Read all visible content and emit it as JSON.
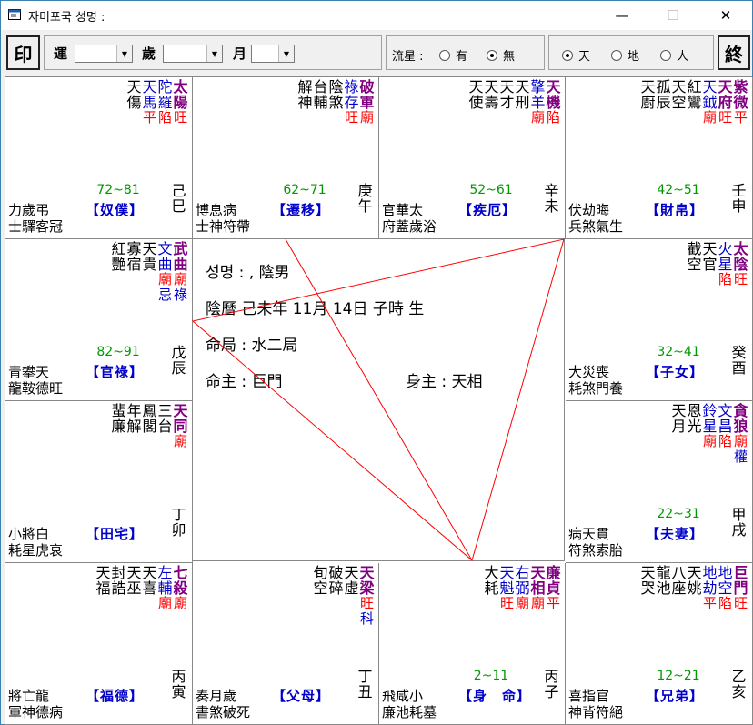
{
  "window": {
    "title": "자미포국    성명 :",
    "minimize": "—",
    "maximize": "☐",
    "close": "✕"
  },
  "toolbar": {
    "seal": "印",
    "yun": "運",
    "sui": "歲",
    "yue": "月",
    "liuxing": "流星 :",
    "you": "有",
    "wu": "無",
    "tian": "天",
    "di": "地",
    "ren": "人",
    "end": "終"
  },
  "center": {
    "name": "성명 : , 陰男",
    "birth": "陰曆 己未年 11月 14日 子時 生",
    "ju": "命局 : 水二局",
    "mingzhu": "命主 : 巨門",
    "shenzhu": "身主 : 天相"
  },
  "palaces": [
    {
      "id": "si",
      "cols": [
        [
          "太",
          "陽",
          "旺"
        ],
        [
          "陀",
          "羅",
          "陷"
        ],
        [
          "天",
          "馬",
          "平"
        ],
        [
          "天",
          "傷"
        ]
      ],
      "age": "72~81",
      "pname": "【奴僕】",
      "gz": [
        "己",
        "巳"
      ],
      "bottom": [
        "力歲弔",
        "士驛客冠"
      ]
    },
    {
      "id": "wu",
      "cols": [
        [
          "破",
          "軍",
          "廟"
        ],
        [
          "祿",
          "存",
          "旺"
        ],
        [
          "陰",
          "煞"
        ],
        [
          "台",
          "輔"
        ],
        [
          "解",
          "神"
        ]
      ],
      "age": "62~71",
      "pname": "【遷移】",
      "gz": [
        "庚",
        "午"
      ],
      "bottom": [
        "博息病",
        "士神符帶"
      ]
    },
    {
      "id": "wei",
      "cols": [
        [
          "天",
          "機",
          "陷"
        ],
        [
          "擎",
          "羊",
          "廟"
        ],
        [
          "天",
          "刑"
        ],
        [
          "天",
          "才"
        ],
        [
          "天",
          "壽"
        ],
        [
          "天",
          "使"
        ]
      ],
      "age": "52~61",
      "pname": "【疾厄】",
      "gz": [
        "辛",
        "未"
      ],
      "bottom": [
        "官華太",
        "府蓋歲浴"
      ]
    },
    {
      "id": "shen",
      "cols": [
        [
          "紫",
          "微",
          "平"
        ],
        [
          "天",
          "府",
          "旺"
        ],
        [
          "天",
          "鉞",
          "廟"
        ],
        [
          "紅",
          "鸞"
        ],
        [
          "天",
          "空"
        ],
        [
          "孤",
          "辰"
        ],
        [
          "天",
          "廚"
        ]
      ],
      "age": "42~51",
      "pname": "【財帛】",
      "gz": [
        "壬",
        "申"
      ],
      "bottom": [
        "伏劫晦",
        "兵煞氣生"
      ]
    },
    {
      "id": "chen",
      "cols": [
        [
          "武",
          "曲",
          "廟",
          "祿"
        ],
        [
          "文",
          "曲",
          "廟",
          "忌"
        ],
        [
          "天",
          "貴"
        ],
        [
          "寡",
          "宿"
        ],
        [
          "紅",
          "艷"
        ]
      ],
      "age": "82~91",
      "pname": "【官祿】",
      "gz": [
        "戊",
        "辰"
      ],
      "bottom": [
        "青攀天",
        "龍鞍德旺"
      ]
    },
    {
      "id": "you",
      "cols": [
        [
          "太",
          "陰",
          "旺"
        ],
        [
          "火",
          "星",
          "陷"
        ],
        [
          "天",
          "官"
        ],
        [
          "截",
          "空"
        ]
      ],
      "age": "32~41",
      "pname": "【子女】",
      "gz": [
        "癸",
        "酉"
      ],
      "bottom": [
        "大災喪",
        "耗煞門養"
      ]
    },
    {
      "id": "mao",
      "cols": [
        [
          "天",
          "同",
          "廟"
        ],
        [
          "三",
          "台"
        ],
        [
          "鳳",
          "閣"
        ],
        [
          "年",
          "解"
        ],
        [
          "蜚",
          "廉"
        ]
      ],
      "age": "",
      "pname": "【田宅】",
      "gz": [
        "丁",
        "卯"
      ],
      "bottom": [
        "小將白",
        "耗星虎衰"
      ]
    },
    {
      "id": "xu",
      "cols": [
        [
          "貪",
          "狼",
          "廟",
          "權"
        ],
        [
          "文",
          "昌",
          "陷"
        ],
        [
          "鈴",
          "星",
          "廟"
        ],
        [
          "恩",
          "光"
        ],
        [
          "天",
          "月"
        ]
      ],
      "age": "22~31",
      "pname": "【夫妻】",
      "gz": [
        "甲",
        "戌"
      ],
      "bottom": [
        "病天貫",
        "符煞索胎"
      ]
    },
    {
      "id": "yin",
      "cols": [
        [
          "七",
          "殺",
          "廟"
        ],
        [
          "左",
          "輔",
          "廟"
        ],
        [
          "天",
          "喜"
        ],
        [
          "天",
          "巫"
        ],
        [
          "封",
          "誥"
        ],
        [
          "天",
          "福"
        ]
      ],
      "age": "",
      "pname": "【福德】",
      "gz": [
        "丙",
        "寅"
      ],
      "bottom": [
        "將亡龍",
        "軍神德病"
      ]
    },
    {
      "id": "chou",
      "cols": [
        [
          "天",
          "梁",
          "旺",
          "科"
        ],
        [
          "天",
          "虛"
        ],
        [
          "破",
          "碎"
        ],
        [
          "旬",
          "空"
        ]
      ],
      "age": "",
      "pname": "【父母】",
      "gz": [
        "丁",
        "丑"
      ],
      "bottom": [
        "奏月歲",
        "書煞破死"
      ]
    },
    {
      "id": "zi",
      "cols": [
        [
          "廉",
          "貞",
          "平"
        ],
        [
          "天",
          "相",
          "廟"
        ],
        [
          "右",
          "弼",
          "廟"
        ],
        [
          "天",
          "魁",
          "旺"
        ],
        [
          "大",
          "耗"
        ]
      ],
      "age": "2~11",
      "pname": "【身　命】",
      "gz": [
        "丙",
        "子"
      ],
      "bottom": [
        "飛咸小",
        "廉池耗墓"
      ]
    },
    {
      "id": "hai",
      "cols": [
        [
          "巨",
          "門",
          "旺"
        ],
        [
          "地",
          "空",
          "陷"
        ],
        [
          "地",
          "劫",
          "平"
        ],
        [
          "天",
          "姚"
        ],
        [
          "八",
          "座"
        ],
        [
          "龍",
          "池"
        ],
        [
          "天",
          "哭"
        ]
      ],
      "age": "12~21",
      "pname": "【兄弟】",
      "gz": [
        "乙",
        "亥"
      ],
      "bottom": [
        "喜指官",
        "神背符絕"
      ]
    }
  ],
  "colors": {
    "main": "#800080",
    "aux": "#0000cc",
    "bright": "#ff0000",
    "age": "#009900",
    "line": "#ff0000"
  }
}
